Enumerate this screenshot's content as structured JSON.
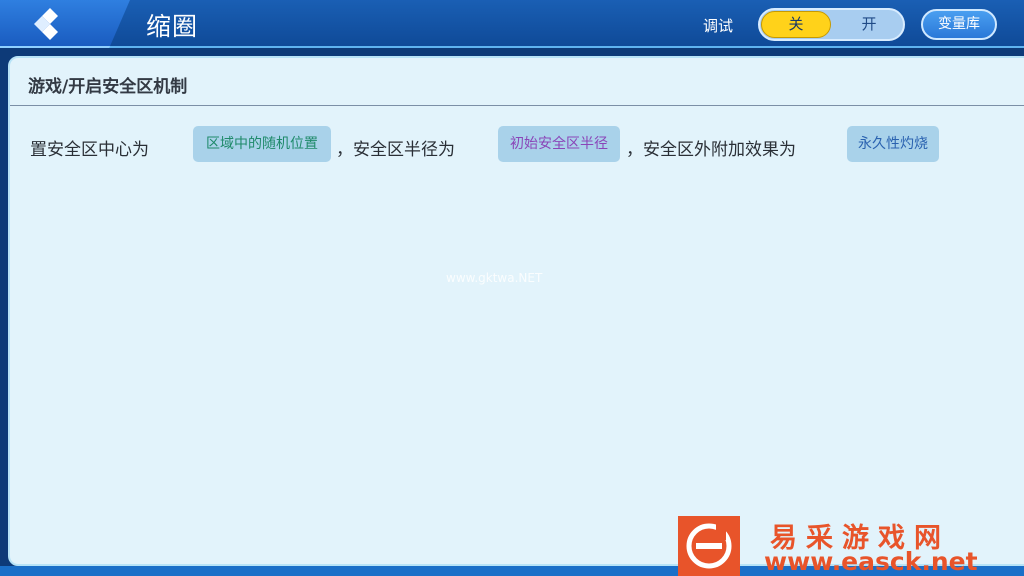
{
  "header": {
    "title": "缩圈",
    "debug_label": "调试",
    "toggle_off_label": "关",
    "toggle_on_label": "开",
    "toggle_state": "关",
    "variable_library_label": "变量库"
  },
  "panel": {
    "breadcrumb": "游戏/开启安全区机制",
    "sentence": {
      "text1": "置安全区中心为",
      "chip1": "区域中的随机位置",
      "text2": "，安全区半径为",
      "chip2": "初始安全区半径",
      "text3": "，安全区外附加效果为",
      "chip3": "永久性灼烧"
    }
  },
  "watermark": "www.gktwa.NET",
  "corner_logo": {
    "name": "易采游戏网",
    "url": "www.easck.net"
  },
  "colors": {
    "accent": "#ffd21a",
    "header_bg": "#0f4a98",
    "panel_bg": "#e2f3fb",
    "chip_bg": "#a9d2ea",
    "chip1_text": "#1e8a6a",
    "chip2_text": "#8a45b8",
    "chip3_text": "#2a62b0",
    "logo": "#e8542a"
  },
  "icons": {
    "back": "diamond-back-icon",
    "logo": "easck-logo-icon"
  }
}
